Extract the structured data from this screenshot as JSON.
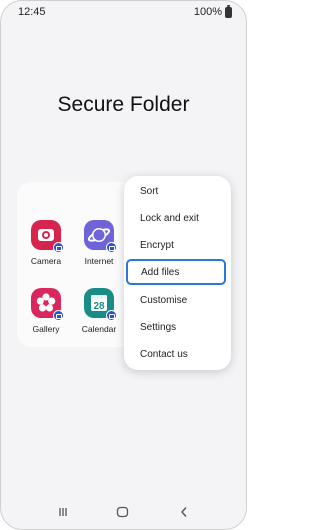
{
  "status_bar": {
    "time": "12:45",
    "battery": "100%"
  },
  "title": "Secure Folder",
  "apps": [
    {
      "label": "Camera",
      "color": "#d6244f",
      "icon": "camera-icon"
    },
    {
      "label": "Internet",
      "color": "#6f63d9",
      "icon": "internet-planet-icon"
    },
    {
      "label": "Gallery",
      "color": "#d9275e",
      "icon": "gallery-flower-icon"
    },
    {
      "label": "Calendar",
      "color": "#1a8c86",
      "icon": "calendar-icon",
      "day": "28"
    }
  ],
  "menu": {
    "items": [
      "Sort",
      "Lock and exit",
      "Encrypt",
      "Add files",
      "Customise",
      "Settings",
      "Contact us"
    ],
    "highlighted": "Add files",
    "highlight_color": "#2a78d8"
  },
  "nav": {
    "icons": [
      "recents-icon",
      "home-icon",
      "back-icon"
    ]
  }
}
